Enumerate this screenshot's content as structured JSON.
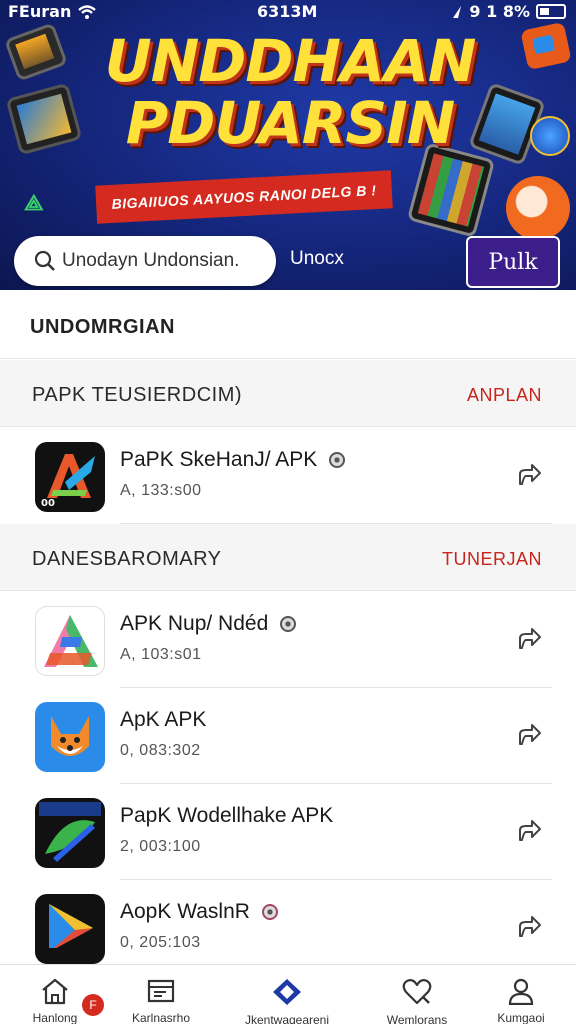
{
  "status_bar": {
    "carrier": "FEuran",
    "time": "6313M",
    "right_info": "9 1 8%",
    "icons": [
      "wifi-icon",
      "location-icon",
      "battery-icon"
    ]
  },
  "banner": {
    "title_line1": "UNDDHAAN",
    "title_line2": "PDUARSIN",
    "ribbon_text": "BIGAIIUOS AAYUOS RANOI DELG B !"
  },
  "search": {
    "placeholder": "Unodayn Undonsian.",
    "link_label": "Unocx",
    "button_label": "Pulk"
  },
  "main": {
    "section_title": "UNDOMRGIAN",
    "groups": [
      {
        "title": "PAPK  TEUSIERDCIM)",
        "link": "ANPLAN",
        "apps": [
          {
            "name": "PaPK SkeHanJ/ APK",
            "meta": "A, 133:s00",
            "has_badge": true
          }
        ]
      },
      {
        "title": "DANESBAROMARY",
        "link": "TUNERJAN",
        "apps": [
          {
            "name": "APK Nup/ Ndéd",
            "meta": "A, 103:s01",
            "has_badge": true
          },
          {
            "name": "ApK APK",
            "meta": "0, 083:302",
            "has_badge": false
          },
          {
            "name": "PapK Wodellhake APK",
            "meta": "2, 003:100",
            "has_badge": false
          },
          {
            "name": "AopK WaslnR",
            "meta": "0, 205:103",
            "has_badge": true
          }
        ]
      }
    ]
  },
  "bottom_nav": {
    "badge": "F",
    "items": [
      {
        "label": "Hanlong",
        "icon": "home-icon"
      },
      {
        "label": "Karlnasrho",
        "icon": "folder-icon"
      },
      {
        "label": "Jkentwaqeareni",
        "icon": "diamond-icon"
      },
      {
        "label": "Wemlorans",
        "icon": "heart-search-icon"
      },
      {
        "label": "Kumgaoi",
        "icon": "user-icon"
      }
    ]
  },
  "colors": {
    "banner_bg": "#14257a",
    "accent_red": "#c8241c",
    "button_purple": "#3c1e8a",
    "title_yellow": "#ffe13a"
  }
}
